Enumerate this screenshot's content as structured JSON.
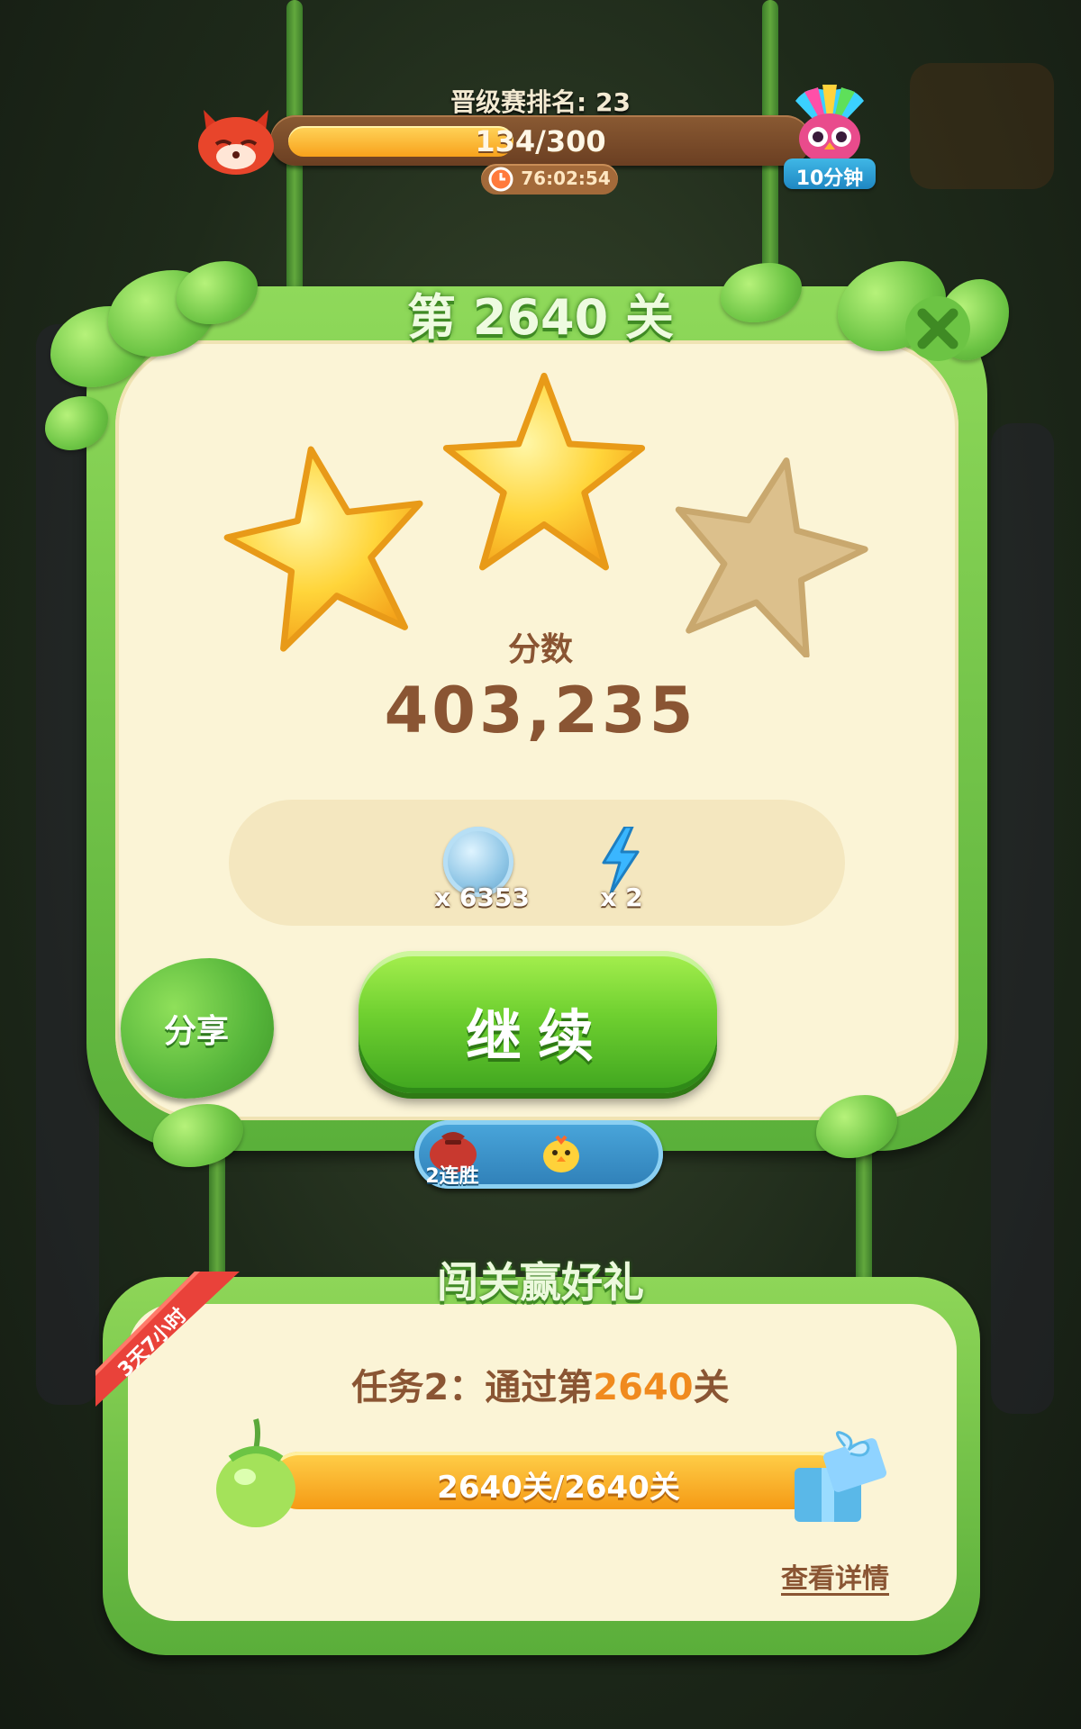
{
  "top_bar": {
    "rank_label": "晋级赛排名: 23",
    "progress_text": "134/300",
    "progress_value": 134,
    "progress_max": 300,
    "timer": "76:02:54",
    "reward_badge": "10分钟"
  },
  "level_panel": {
    "title": "第 2640 关",
    "stars_earned": 2,
    "stars_total": 3,
    "score_label": "分数",
    "score_value": "403,235",
    "rewards": [
      {
        "icon": "feather-coin-icon",
        "amount": "x 6353"
      },
      {
        "icon": "lightning-icon",
        "amount": "x 2"
      }
    ],
    "share_label": "分享",
    "continue_label": "继续",
    "streak_label": "2连胜"
  },
  "event_panel": {
    "title": "闯关赢好礼",
    "ribbon_text": "3天7小时",
    "task_prefix": "任务2：通过第",
    "task_level": "2640",
    "task_suffix": "关",
    "progress_text": "2640关/2640关",
    "progress_fraction": 1.0,
    "details_link": "查看详情"
  },
  "colors": {
    "panel_green": "#6cc444",
    "panel_cream": "#fbf4d6",
    "text_brown": "#8a5533",
    "accent_orange": "#f08a1e",
    "button_green": "#6fd030",
    "streak_blue": "#2f7fb7"
  }
}
